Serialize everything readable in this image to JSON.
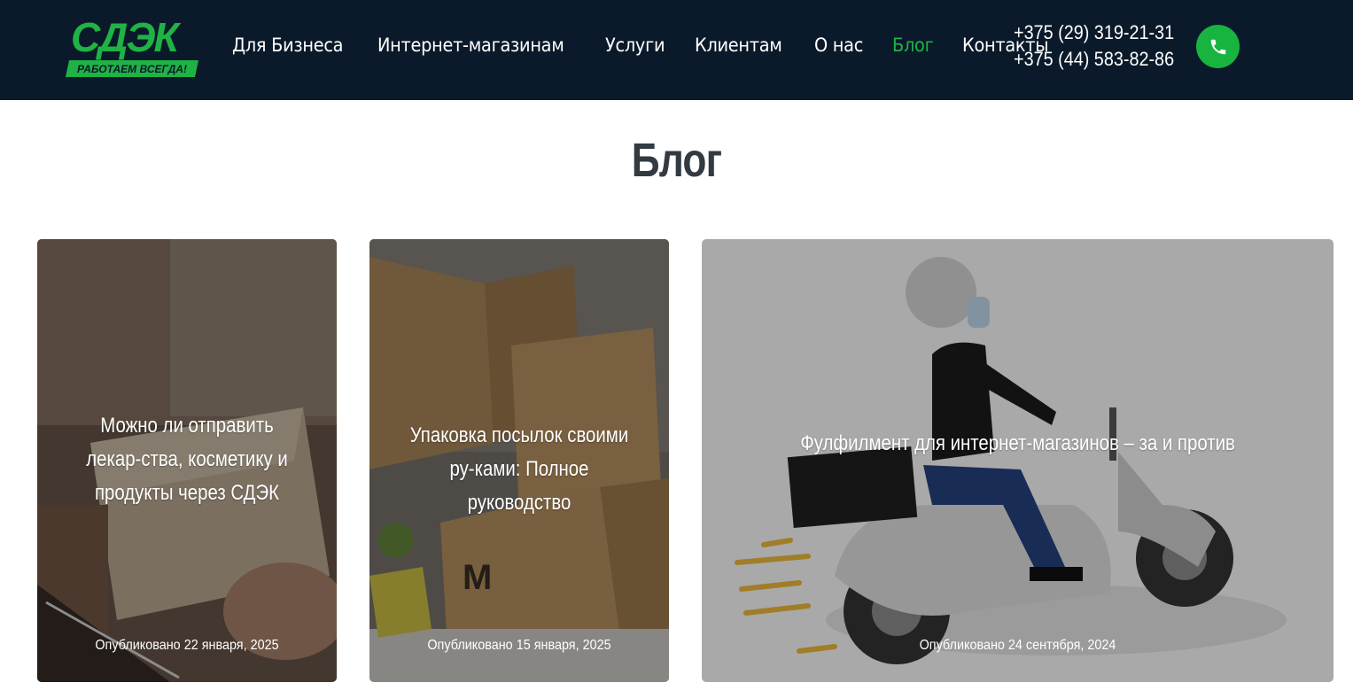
{
  "brand": {
    "name": "СДЭК",
    "tagline": "РАБОТАЕМ ВСЕГДА!"
  },
  "nav": [
    {
      "label": "Для Бизнеса",
      "active": false
    },
    {
      "label": "Интернет-магазинам",
      "active": false
    },
    {
      "label": "Услуги",
      "active": false
    },
    {
      "label": "Клиентам",
      "active": false
    },
    {
      "label": "О нас",
      "active": false
    },
    {
      "label": "Блог",
      "active": true
    },
    {
      "label": "Контакты",
      "active": false
    }
  ],
  "phones": [
    "+375 (29) 319-21-31",
    "+375 (44) 583-82-86"
  ],
  "call_icon": "phone-icon",
  "page": {
    "title": "Блог"
  },
  "posts": [
    {
      "title": "Можно ли отправить лекар-ства, косметику и продукты через СДЭК",
      "date": "Опубликовано 22 января, 2025"
    },
    {
      "title": "Упаковка посылок своими ру-ками: Полное руководство",
      "date": "Опубликовано 15 января, 2025"
    },
    {
      "title": "Фулфилмент для интернет-магазинов – за и против",
      "date": "Опубликовано 24 сентября, 2024"
    }
  ],
  "colors": {
    "header_bg": "#0b1a2b",
    "accent": "#1fb346",
    "title": "#333a41"
  }
}
